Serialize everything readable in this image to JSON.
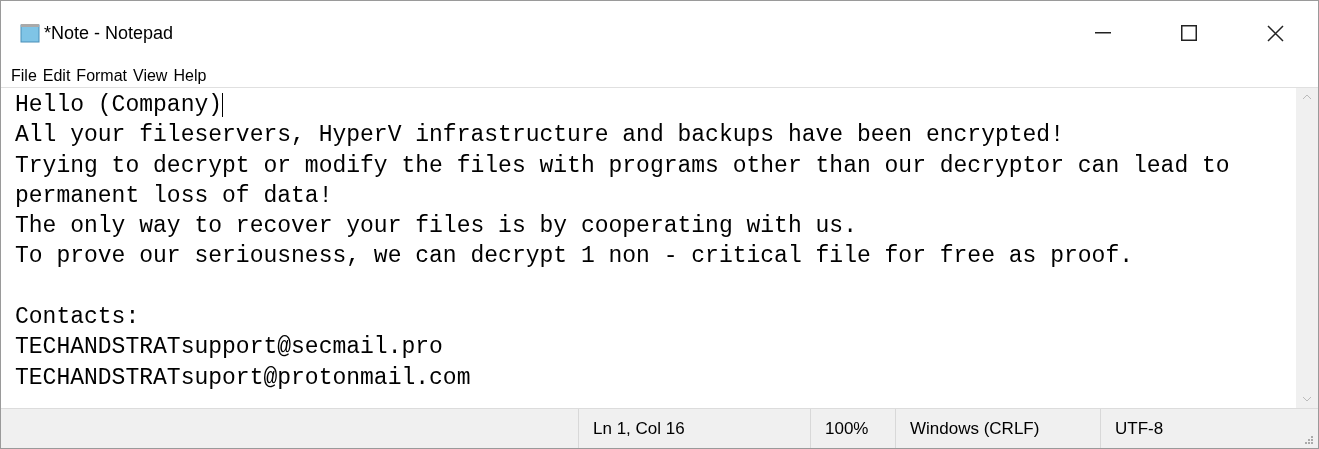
{
  "window": {
    "title": "*Note - Notepad"
  },
  "menu": [
    {
      "label": "File"
    },
    {
      "label": "Edit"
    },
    {
      "label": "Format"
    },
    {
      "label": "View"
    },
    {
      "label": "Help"
    }
  ],
  "editor": {
    "lines": [
      {
        "text": "Hello (Company)",
        "caret": true
      },
      {
        "text": "All your fileservers, HyperV infrastructure and backups have been encrypted!",
        "caret": false
      },
      {
        "text": "Trying to decrypt or modify the files with programs other than our decryptor can lead to",
        "caret": false
      },
      {
        "text": "permanent loss of data!",
        "caret": false
      },
      {
        "text": "The only way to recover your files is by cooperating with us.",
        "caret": false
      },
      {
        "text": "To prove our seriousness, we can decrypt 1 non - critical file for free as proof.",
        "caret": false
      },
      {
        "caret": false
      },
      {
        "text": "Contacts:",
        "caret": false
      },
      {
        "text": "TECHANDSTRATsupport@secmail.pro",
        "caret": false
      },
      {
        "text": "TECHANDSTRATsuport@protonmail.com",
        "caret": false
      }
    ]
  },
  "status_bar": [
    "Ln 1, Col 16",
    "100%",
    "Windows (CRLF)",
    "UTF-8"
  ]
}
